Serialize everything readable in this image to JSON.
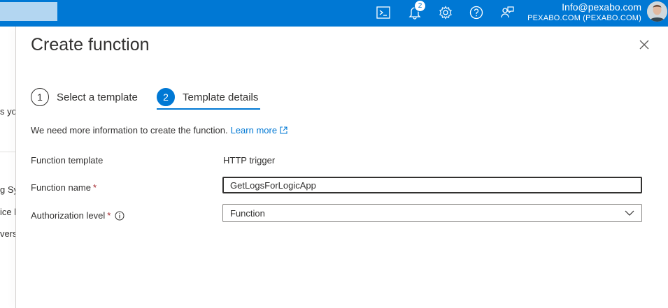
{
  "topbar": {
    "search_placeholder": "",
    "notification_count": "2",
    "account_email": "Info@pexabo.com",
    "account_tenant": "PEXABO.COM (PEXABO.COM)",
    "accent_color": "#0078d4"
  },
  "background": {
    "fragments": [
      "s yo",
      "g Sy",
      "ice l",
      "vers"
    ]
  },
  "blade": {
    "title": "Create function",
    "steps": [
      {
        "number": "1",
        "label": "Select a template",
        "active": false
      },
      {
        "number": "2",
        "label": "Template details",
        "active": true
      }
    ],
    "info_text": "We need more information to create the function.",
    "learn_more": "Learn more",
    "fields": {
      "template_label": "Function template",
      "template_value": "HTTP trigger",
      "name_label": "Function name",
      "name_value": "GetLogsForLogicApp",
      "auth_label": "Authorization level",
      "auth_value": "Function",
      "required_mark": "*"
    }
  },
  "icons": [
    "cloud-shell-icon",
    "bell-icon",
    "gear-icon",
    "help-icon",
    "feedback-icon",
    "close-icon",
    "external-link-icon",
    "info-icon",
    "chevron-down-icon"
  ]
}
